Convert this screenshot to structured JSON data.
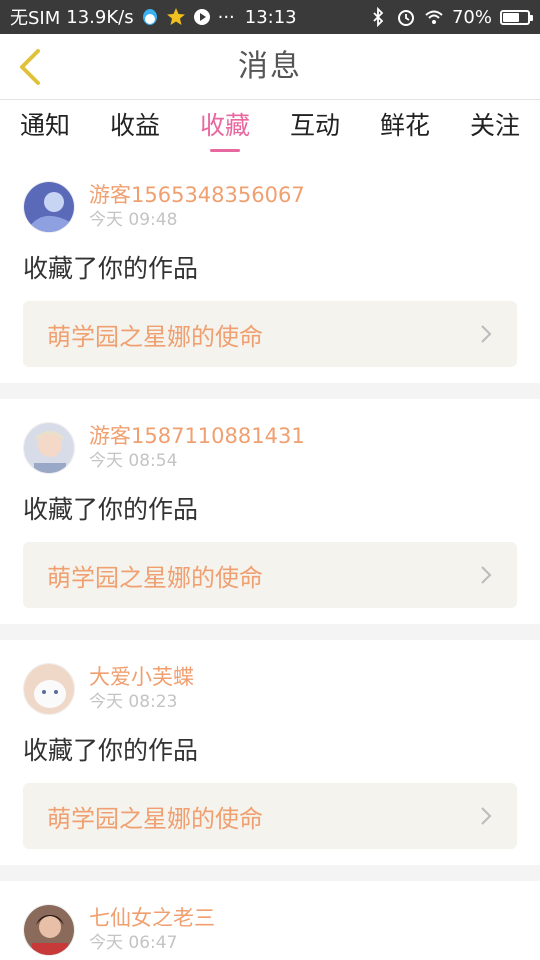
{
  "status_bar": {
    "carrier": "无SIM",
    "speed": "13.9K/s",
    "time": "13:13",
    "battery_percent": "70%",
    "battery_level": 0.7,
    "icons": [
      "qq-icon",
      "star-app-icon",
      "media-icon",
      "more-dots-icon",
      "bluetooth-icon",
      "alarm-icon",
      "wifi-icon",
      "battery-icon"
    ],
    "more": "···"
  },
  "header": {
    "title": "消息",
    "back_icon": "chevron-left-icon",
    "accent": "#e0c23a"
  },
  "tabs": [
    {
      "label": "通知"
    },
    {
      "label": "收益"
    },
    {
      "label": "收藏",
      "active": true
    },
    {
      "label": "互动"
    },
    {
      "label": "鲜花"
    },
    {
      "label": "关注"
    }
  ],
  "colors": {
    "active_tab": "#e868a0",
    "username": "#f0a070",
    "work_title": "#f0a070"
  },
  "messages": [
    {
      "username": "游客1565348356067",
      "time": "今天 09:48",
      "action": "收藏了你的作品",
      "work": "萌学园之星娜的使命"
    },
    {
      "username": "游客1587110881431",
      "time": "今天 08:54",
      "action": "收藏了你的作品",
      "work": "萌学园之星娜的使命"
    },
    {
      "username": "大爱小芙蝶",
      "time": "今天 08:23",
      "action": "收藏了你的作品",
      "work": "萌学园之星娜的使命"
    },
    {
      "username": "七仙女之老三",
      "time": "今天 06:47",
      "action": "",
      "work": ""
    }
  ]
}
